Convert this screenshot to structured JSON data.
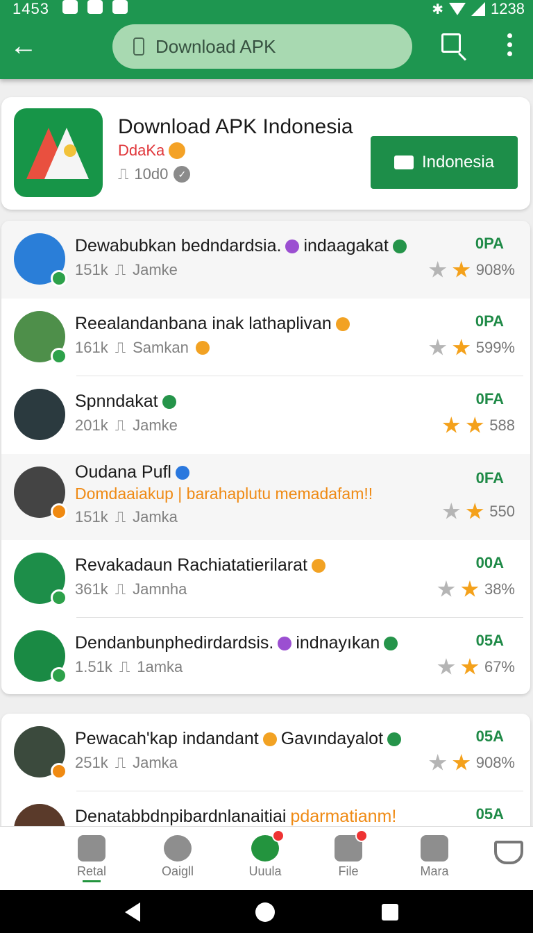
{
  "status_bar": {
    "time": "1453",
    "right_text": "1238"
  },
  "toolbar": {
    "search_text": "Download APK"
  },
  "header": {
    "title": "Download APK Indonesia",
    "subtitle": "DdaKa",
    "count": "10d0",
    "button_label": "Indonesia"
  },
  "list1": [
    {
      "title": "Dewabubkan bedndardsia.",
      "title_extra": "indaagakat",
      "meta1": "151k",
      "meta2": "Jamke",
      "right": "0PA",
      "pct": "908%",
      "stars": [
        "grey",
        "gold"
      ]
    },
    {
      "title": "Reealandanbana inak lathaplivan",
      "title_extra": "",
      "meta1": "161k",
      "meta2": "Samkan",
      "right": "0PA",
      "pct": "599%",
      "stars": [
        "grey",
        "gold"
      ]
    },
    {
      "title": "Spnndakat",
      "title_extra": "",
      "meta1": "201k",
      "meta2": "Jamke",
      "right": "0FA",
      "pct": "588",
      "stars": [
        "gold",
        "gold"
      ]
    },
    {
      "title": "Oudana Pufl",
      "title_extra": "",
      "sub": "Domdaaiakup | barahaplutu memadafam!!",
      "meta1": "151k",
      "meta2": "Jamka",
      "right": "0FA",
      "pct": "550",
      "stars": [
        "grey",
        "gold"
      ]
    },
    {
      "title": "Revakadaun Rachiatatierilarat",
      "title_extra": "",
      "meta1": "361k",
      "meta2": "Jamnha",
      "right": "00A",
      "pct": "38%",
      "stars": [
        "grey",
        "gold"
      ]
    },
    {
      "title": "Dendanbunphedirdardsis.",
      "title_extra": "indnayıkan",
      "meta1": "1.51k",
      "meta2": "1amka",
      "right": "05A",
      "pct": "67%",
      "stars": [
        "grey",
        "gold"
      ]
    }
  ],
  "list2": [
    {
      "title": "Pewacah'kap indandant",
      "title_extra": "Gavındayalot",
      "meta1": "251k",
      "meta2": "Jamka",
      "right": "05A",
      "pct": "908%",
      "stars": [
        "grey",
        "gold"
      ]
    },
    {
      "title": "Denatabbdnpibardnlanaitiai",
      "title_extra": "pdarmatianm!",
      "right": "05A"
    }
  ],
  "bottom_nav": [
    "Retal",
    "Oaigll",
    "Uuula",
    "File",
    "Mara"
  ],
  "colors": {
    "primary": "#1e9650",
    "accent": "#f4a11b"
  }
}
